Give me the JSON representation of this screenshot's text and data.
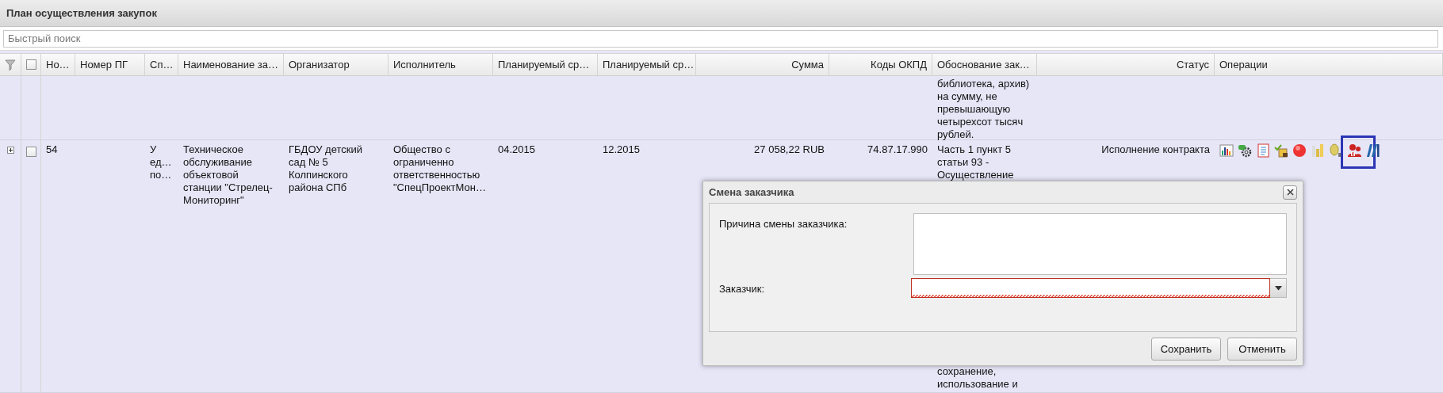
{
  "panel": {
    "title": "План осуществления закупок"
  },
  "search": {
    "placeholder": "Быстрый поиск"
  },
  "table": {
    "select_all": {
      "checked": false
    },
    "columns": [
      {
        "label": "Но…"
      },
      {
        "label": "Номер ПГ"
      },
      {
        "label": "Сп…"
      },
      {
        "label": "Наименование за…"
      },
      {
        "label": "Организатор"
      },
      {
        "label": "Исполнитель"
      },
      {
        "label": "Планируемый ср…"
      },
      {
        "label": "Планируемый ср…"
      },
      {
        "label": "Сумма"
      },
      {
        "label": "Коды ОКПД"
      },
      {
        "label": "Обоснование зак…"
      },
      {
        "label": "Статус"
      },
      {
        "label": "Операции"
      }
    ],
    "rows": [
      {
        "basis": [
          "библиотека, архив)",
          "на сумму, не",
          "превышающую",
          "четырехсот тысяч",
          "рублей."
        ]
      },
      {
        "expanded": false,
        "checked": false,
        "number": [
          "54"
        ],
        "method": [
          "У",
          "ед…",
          "по…"
        ],
        "name": [
          "Техническое",
          "обслуживание",
          "объектовой",
          "станции \"Стрелец-",
          "Мониторинг\""
        ],
        "organizer": [
          "ГБДОУ детский",
          "сад № 5",
          "Колпинского",
          "района СПб"
        ],
        "executor": [
          "Общество с",
          "ограниченно",
          "ответственностью",
          "\"СпецПроектМон…"
        ],
        "planned_start": [
          "04.2015"
        ],
        "planned_end": [
          "12.2015"
        ],
        "sum": [
          "27 058,22 RUB"
        ],
        "okpd": [
          "74.87.17.990"
        ],
        "basis": [
          "Часть 1 пункт 5",
          "статьи 93 -",
          "Осуществление"
        ],
        "basis_continued": [
          "сохранение,",
          "использование и"
        ],
        "status": [
          "Исполнение контракта"
        ],
        "operations": [
          {
            "kind": "chart",
            "highlighted": false
          },
          {
            "kind": "gear",
            "highlighted": false
          },
          {
            "kind": "document",
            "highlighted": false
          },
          {
            "kind": "check-note",
            "highlighted": false
          },
          {
            "kind": "record",
            "highlighted": false
          },
          {
            "kind": "bars",
            "highlighted": false
          },
          {
            "kind": "coin",
            "highlighted": false
          },
          {
            "kind": "people",
            "highlighted": true
          },
          {
            "kind": "books",
            "highlighted": false
          }
        ]
      }
    ]
  },
  "dialog": {
    "title": "Смена заказчика",
    "fields": [
      {
        "label": "Причина смены заказчика:",
        "kind": "textarea",
        "invalid": false
      },
      {
        "label": "Заказчик:",
        "kind": "combo",
        "invalid": true
      }
    ],
    "buttons": [
      "Сохранить",
      "Отменить"
    ]
  }
}
